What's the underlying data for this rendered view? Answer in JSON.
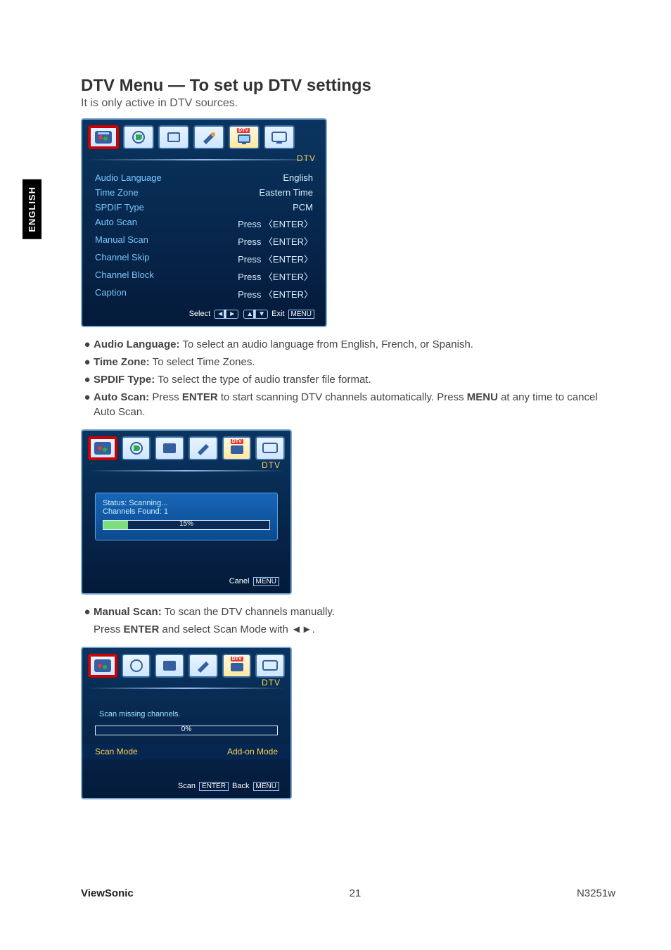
{
  "sideTab": "ENGLISH",
  "heading": "DTV Menu — To set up DTV settings",
  "subtitle": "It is only active in DTV sources.",
  "osd1": {
    "titleRight": "DTV",
    "footerSelect": "Select",
    "footerExit": "Exit",
    "footerMenu": "MENU",
    "rows": [
      {
        "label": "Audio Language",
        "value": "English"
      },
      {
        "label": "Time Zone",
        "value": "Eastern Time"
      },
      {
        "label": "SPDIF Type",
        "value": "PCM"
      },
      {
        "label": "Auto Scan",
        "value": "Press  〈ENTER〉"
      },
      {
        "label": "Manual Scan",
        "value": "Press  〈ENTER〉"
      },
      {
        "label": "Channel Skip",
        "value": "Press  〈ENTER〉"
      },
      {
        "label": "Channel Block",
        "value": "Press  〈ENTER〉"
      },
      {
        "label": "Caption",
        "value": "Press  〈ENTER〉"
      }
    ]
  },
  "bullets1": [
    {
      "bold": "Audio Language:",
      "text": " To select an audio language from English, French, or Spanish."
    },
    {
      "bold": "Time Zone:",
      "text": " To select Time Zones."
    },
    {
      "bold": "SPDIF Type:",
      "text": " To select the type of audio transfer file format."
    }
  ],
  "autoScanBullet": {
    "preBold": "Auto Scan:",
    "textBeforeEnter": " Press ",
    "enter": "ENTER",
    "textMid": " to start scanning DTV channels automatically. Press ",
    "menu": "MENU",
    "textAfter": " at any time to cancel Auto Scan."
  },
  "osd2": {
    "titleRight": "DTV",
    "status": "Status: Scanning...",
    "found": "Channels Found: 1",
    "pct": "15%",
    "pctVal": 15,
    "footerCancel": "Canel",
    "footerMenu": "MENU"
  },
  "manualScanBullet": {
    "bold": "Manual Scan:",
    "line1": " To scan the DTV channels manually.",
    "line2a": "Press ",
    "enter": "ENTER",
    "line2b": " and select Scan Mode with ◄►."
  },
  "osd3": {
    "titleRight": "DTV",
    "msg": "Scan missing channels.",
    "pct": "0%",
    "pctVal": 0,
    "modeLabel": "Scan Mode",
    "modeValue": "Add-on Mode",
    "footerScan": "Scan",
    "footerEnter": "ENTER",
    "footerBack": "Back",
    "footerMenu": "MENU"
  },
  "footer": {
    "left": "ViewSonic",
    "center": "21",
    "right": "N3251w"
  },
  "icons": {
    "picture": "picture-icon",
    "audio": "audio-icon",
    "screen": "screen-icon",
    "setup": "setup-icon",
    "dtv": "dtv-icon",
    "pc": "pc-icon",
    "dtvBadge": "DTV"
  }
}
